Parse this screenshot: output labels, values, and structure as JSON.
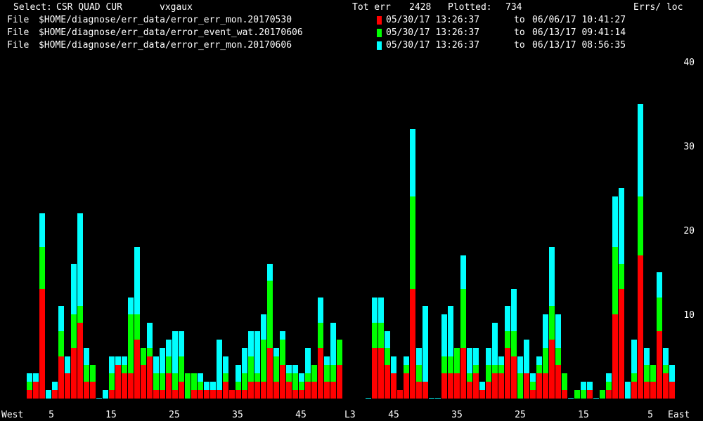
{
  "header": {
    "select_label": "Select:",
    "select_value": "CSR QUAD CUR",
    "host": "vxgaux",
    "tot_err_label": "Tot err",
    "tot_err_value": "2428",
    "plotted_label": "Plotted:",
    "plotted_value": "734",
    "units_label": "Errs/ loc"
  },
  "files": [
    {
      "label": "File",
      "path": "$HOME/diagnose/err_data/error_err_mon.20170530",
      "color": "#ff0000",
      "from": "05/30/17 13:26:37",
      "to_label": "to",
      "to": "06/06/17 10:41:27"
    },
    {
      "label": "File",
      "path": "$HOME/diagnose/err_data/error_event_wat.20170606",
      "color": "#00ff00",
      "from": "05/30/17 13:26:37",
      "to_label": "to",
      "to": "06/13/17 09:41:14"
    },
    {
      "label": "File",
      "path": "$HOME/diagnose/err_data/error_err_mon.20170606",
      "color": "#00ffff",
      "from": "05/30/17 13:26:37",
      "to_label": "to",
      "to": "06/13/17 08:56:35"
    }
  ],
  "chart_data": {
    "type": "bar",
    "stacked": true,
    "y_ticks": [
      "10",
      "20",
      "30",
      "40"
    ],
    "ylim": [
      0,
      40
    ],
    "grid": false,
    "series_colors": [
      "#ff0000",
      "#00ff00",
      "#00ffff"
    ],
    "west_panel": {
      "label_left": "West",
      "x_ticks": [
        "5",
        "15",
        "25",
        "35",
        "45"
      ],
      "bars": [
        [
          1,
          1,
          1
        ],
        [
          2,
          0,
          1
        ],
        [
          13,
          5,
          4
        ],
        [
          0,
          0,
          1
        ],
        [
          1,
          0,
          1
        ],
        [
          5,
          3,
          3
        ],
        [
          3,
          0,
          2
        ],
        [
          6,
          4,
          6
        ],
        [
          9,
          2,
          11
        ],
        [
          2,
          2,
          2
        ],
        [
          2,
          2,
          0
        ],
        [
          0,
          0,
          0
        ],
        [
          0,
          0,
          1
        ],
        [
          1,
          2,
          2
        ],
        [
          4,
          0,
          1
        ],
        [
          3,
          1,
          1
        ],
        [
          3,
          7,
          2
        ],
        [
          7,
          3,
          8
        ],
        [
          4,
          2,
          0
        ],
        [
          5,
          1,
          3
        ],
        [
          1,
          2,
          2
        ],
        [
          1,
          2,
          3
        ],
        [
          3,
          2,
          2
        ],
        [
          1,
          2,
          5
        ],
        [
          2,
          3,
          3
        ],
        [
          0,
          3,
          0
        ],
        [
          1,
          2,
          0
        ],
        [
          1,
          1,
          1
        ],
        [
          1,
          0,
          1
        ],
        [
          1,
          0,
          1
        ],
        [
          1,
          0,
          6
        ],
        [
          2,
          1,
          2
        ],
        [
          1,
          0,
          0
        ],
        [
          1,
          1,
          2
        ],
        [
          1,
          2,
          3
        ],
        [
          2,
          3,
          3
        ],
        [
          2,
          1,
          5
        ],
        [
          2,
          5,
          3
        ],
        [
          6,
          8,
          2
        ],
        [
          2,
          3,
          1
        ],
        [
          4,
          3,
          1
        ],
        [
          2,
          1,
          1
        ],
        [
          1,
          2,
          1
        ],
        [
          1,
          1,
          1
        ],
        [
          2,
          1,
          3
        ],
        [
          2,
          2,
          0
        ],
        [
          6,
          3,
          3
        ],
        [
          2,
          2,
          1
        ],
        [
          2,
          2,
          5
        ],
        [
          4,
          3,
          0
        ]
      ]
    },
    "east_panel": {
      "label_left": "L3",
      "label_right": "East",
      "x_ticks": [
        "45",
        "35",
        "25",
        "15",
        "5"
      ],
      "bars": [
        [
          0,
          0,
          0
        ],
        [
          6,
          3,
          3
        ],
        [
          6,
          3,
          3
        ],
        [
          4,
          2,
          2
        ],
        [
          3,
          0,
          2
        ],
        [
          1,
          0,
          0
        ],
        [
          3,
          1,
          1
        ],
        [
          13,
          11,
          8
        ],
        [
          2,
          2,
          2
        ],
        [
          2,
          0,
          9
        ],
        [
          0,
          0,
          0
        ],
        [
          0,
          0,
          0
        ],
        [
          3,
          2,
          5
        ],
        [
          3,
          2,
          6
        ],
        [
          3,
          3,
          0
        ],
        [
          6,
          7,
          4
        ],
        [
          2,
          1,
          3
        ],
        [
          3,
          1,
          2
        ],
        [
          1,
          0,
          1
        ],
        [
          2,
          2,
          2
        ],
        [
          3,
          1,
          5
        ],
        [
          3,
          1,
          1
        ],
        [
          6,
          2,
          3
        ],
        [
          5,
          3,
          5
        ],
        [
          0,
          3,
          2
        ],
        [
          3,
          0,
          4
        ],
        [
          1,
          1,
          1
        ],
        [
          3,
          1,
          1
        ],
        [
          3,
          3,
          4
        ],
        [
          7,
          4,
          7
        ],
        [
          4,
          2,
          4
        ],
        [
          1,
          2,
          0
        ],
        [
          0,
          0,
          0
        ],
        [
          0,
          1,
          0
        ],
        [
          0,
          1,
          1
        ],
        [
          1,
          0,
          1
        ],
        [
          0,
          0,
          0
        ],
        [
          0,
          1,
          0
        ],
        [
          1,
          1,
          1
        ],
        [
          10,
          8,
          6
        ],
        [
          13,
          3,
          9
        ],
        [
          0,
          0,
          2
        ],
        [
          2,
          1,
          4
        ],
        [
          17,
          7,
          11
        ],
        [
          2,
          2,
          2
        ],
        [
          2,
          2,
          0
        ],
        [
          8,
          4,
          3
        ],
        [
          3,
          1,
          2
        ],
        [
          2,
          0,
          2
        ]
      ]
    }
  }
}
